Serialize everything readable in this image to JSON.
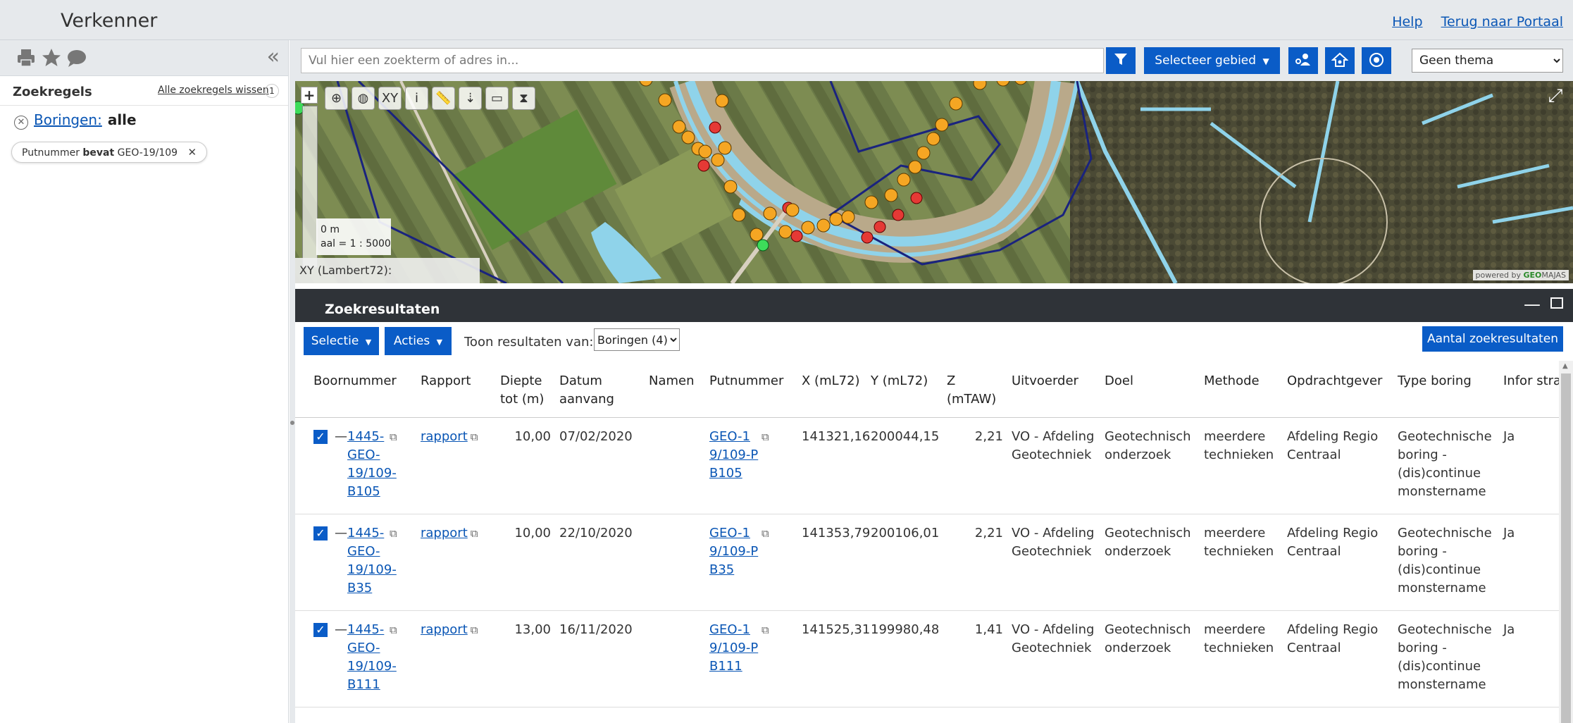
{
  "header": {
    "title": "Verkenner",
    "links": [
      "Help",
      "Terug naar Portaal"
    ]
  },
  "sidebar": {
    "tools": [
      "printer-icon",
      "star-icon",
      "speech-bubble-icon"
    ],
    "rules_title": "Zoekregels",
    "clear_rules": "Alle zoekregels wissen",
    "rule_count": "1",
    "rule": {
      "label": "Boringen:",
      "value": "alle"
    },
    "filter_chip": {
      "field": "Putnummer",
      "operator": "bevat",
      "value": "GEO-19/109"
    }
  },
  "search": {
    "placeholder": "Vul hier een zoekterm of adres in...",
    "area_button": "Selecteer gebied",
    "theme": "Geen thema"
  },
  "map": {
    "tools": [
      "XY",
      "i"
    ],
    "scale_top": "0 m",
    "scale_bottom": "aal = 1 : 5000",
    "coords": "XY (Lambert72):",
    "powered_prefix": "powered by",
    "powered_brand": "GEO",
    "powered_suffix": "MAJAS"
  },
  "results": {
    "title": "Zoekresultaten",
    "selectie": "Selectie",
    "acties": "Acties",
    "show_label": "Toon resultaten van:",
    "result_type": "Boringen (4)",
    "count_button": "Aantal zoekresultaten",
    "columns": [
      "Boornummer",
      "Rapport",
      "Diepte tot (m)",
      "Datum aanvang",
      "Namen",
      "Putnummer",
      "X (mL72)",
      "Y (mL72)",
      "Z (mTAW)",
      "Uitvoerder",
      "Doel",
      "Methode",
      "Opdrachtgever",
      "Type boring",
      "Infor strat"
    ],
    "rows": [
      {
        "boornummer": "1445-GEO-19/109-B105",
        "rapport": "rapport",
        "diepte": "10,00",
        "datum": "07/02/2020",
        "namen": "",
        "putnummer": "GEO-19/109-PB105",
        "x": "141321,16",
        "y": "200044,15",
        "z": "2,21",
        "uitvoerder": "VO - Afdeling Geotechniek",
        "doel": "Geotechnisch onderzoek",
        "methode": "meerdere technieken",
        "opdrachtgever": "Afdeling Regio Centraal",
        "type": "Geotechnische boring - (dis)continue monstername",
        "info": "Ja"
      },
      {
        "boornummer": "1445-GEO-19/109-B35",
        "rapport": "rapport",
        "diepte": "10,00",
        "datum": "22/10/2020",
        "namen": "",
        "putnummer": "GEO-19/109-PB35",
        "x": "141353,79",
        "y": "200106,01",
        "z": "2,21",
        "uitvoerder": "VO - Afdeling Geotechniek",
        "doel": "Geotechnisch onderzoek",
        "methode": "meerdere technieken",
        "opdrachtgever": "Afdeling Regio Centraal",
        "type": "Geotechnische boring - (dis)continue monstername",
        "info": "Ja"
      },
      {
        "boornummer": "1445-GEO-19/109-B111",
        "rapport": "rapport",
        "diepte": "13,00",
        "datum": "16/11/2020",
        "namen": "",
        "putnummer": "GEO-19/109-PB111",
        "x": "141525,31",
        "y": "199980,48",
        "z": "1,41",
        "uitvoerder": "VO - Afdeling Geotechniek",
        "doel": "Geotechnisch onderzoek",
        "methode": "meerdere technieken",
        "opdrachtgever": "Afdeling Regio Centraal",
        "type": "Geotechnische boring - (dis)continue monstername",
        "info": "Ja"
      }
    ]
  },
  "colors": {
    "primary": "#0a5cc7",
    "header_bg": "#e6e9ec",
    "results_header": "#2f3338",
    "marker_orange": "#f5a623",
    "marker_red": "#e53935",
    "marker_green": "#3ddc5a",
    "outline_blue": "#1a237e",
    "water": "#8fd3ea"
  }
}
